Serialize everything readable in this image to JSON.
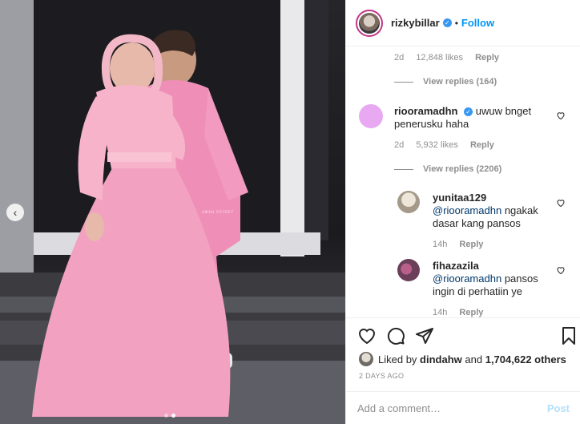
{
  "post": {
    "username": "rizkybillar",
    "follow_label": "Follow",
    "separator": "•",
    "photo_watermark": "AWAH POTRET",
    "carousel_prev": "‹"
  },
  "comments": [
    {
      "meta_time": "2d",
      "meta_likes": "12,848 likes",
      "meta_reply": "Reply",
      "view_replies": "View replies (164)"
    },
    {
      "username": "riooramadhn",
      "text": "uwuw bnget penerusku haha",
      "meta_time": "2d",
      "meta_likes": "5,932 likes",
      "meta_reply": "Reply",
      "view_replies": "View replies (2206)"
    }
  ],
  "replies": [
    {
      "username": "yunitaa129",
      "mention": "@riooramadhn",
      "text": "ngakak dasar kang pansos",
      "meta_time": "14h",
      "meta_reply": "Reply"
    },
    {
      "username": "fihazazila",
      "mention": "@riooramadhn",
      "text": "pansos ingin di perhatiin ye",
      "meta_time": "14h",
      "meta_reply": "Reply"
    }
  ],
  "likes": {
    "prefix": "Liked by",
    "user": "dindahw",
    "joiner": "and",
    "count": "1,704,622 others"
  },
  "date": "2 DAYS AGO",
  "add_comment": {
    "placeholder": "Add a comment…",
    "post_label": "Post"
  },
  "icons": [
    "heart-icon",
    "comment-icon",
    "share-icon",
    "bookmark-icon",
    "verified-icon"
  ],
  "colors": {
    "accent": "#0095f6",
    "verified": "#3897f0",
    "dress": "#f2a2c0",
    "suit": "#ef8fb8"
  }
}
